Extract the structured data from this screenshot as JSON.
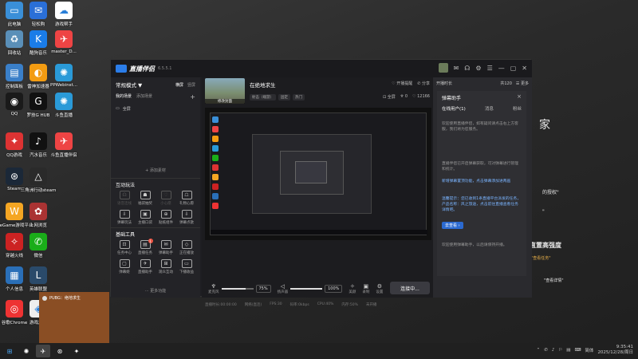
{
  "desktop": {
    "icons": [
      {
        "label": "此电脑",
        "glyph": "▭",
        "color": "#3a8fd8"
      },
      {
        "label": "回收站",
        "glyph": "♻",
        "color": "#5a8fb8"
      },
      {
        "label": "控制面板",
        "glyph": "▤",
        "color": "#3a7fc8"
      },
      {
        "label": "QQ",
        "glyph": "◉",
        "color": "#1a1a1a"
      },
      {
        "label": "QQ游戏",
        "glyph": "✦",
        "color": "#d33"
      },
      {
        "label": "Steam",
        "glyph": "⊛",
        "color": "#1b2838"
      },
      {
        "label": "WeGame游戏平台",
        "glyph": "W",
        "color": "#f5a623"
      },
      {
        "label": "穿越火线",
        "glyph": "✧",
        "color": "#c22"
      },
      {
        "label": "个人信息",
        "glyph": "▦",
        "color": "#2a6fb8"
      },
      {
        "label": "谷歌Chrome",
        "glyph": "◎",
        "color": "#e33"
      },
      {
        "label": "轻松购",
        "glyph": "✉",
        "color": "#2a6fd8"
      },
      {
        "label": "酷狗音乐",
        "glyph": "K",
        "color": "#1a7ce8"
      },
      {
        "label": "雷神加速器",
        "glyph": "◐",
        "color": "#f39c12"
      },
      {
        "label": "罗技G HUB",
        "glyph": "G",
        "color": "#111"
      },
      {
        "label": "汽水音乐",
        "glyph": "♪",
        "color": "#111"
      },
      {
        "label": "三角洲行动steam",
        "glyph": "△",
        "color": "#2a2a2a"
      },
      {
        "label": "上网浏览",
        "glyph": "✿",
        "color": "#a33"
      },
      {
        "label": "微信",
        "glyph": "✆",
        "color": "#1aad19"
      },
      {
        "label": "英雄联盟",
        "glyph": "L",
        "color": "#2a4a6a"
      },
      {
        "label": "游戏加速",
        "glyph": "◈",
        "color": "#eee"
      },
      {
        "label": "游戏帮手",
        "glyph": "☁",
        "color": "#fff"
      },
      {
        "label": "master_D...",
        "glyph": "✈",
        "color": "#e44"
      },
      {
        "label": "PPWebinst...",
        "glyph": "✺",
        "color": "#2a9ad8"
      },
      {
        "label": "斗鱼直播",
        "glyph": "✺",
        "color": "#2a9ad8"
      },
      {
        "label": "斗鱼直播伴侣",
        "glyph": "✈",
        "color": "#e44"
      }
    ],
    "bg_text": {
      "line1": "家",
      "line2": "的授权\"",
      "line3": "\"",
      "line4": "直置高强度",
      "line5": "\"查看任务\"",
      "line6": "\"查看详情\""
    }
  },
  "app": {
    "name": "直播伴侣",
    "version": "6.5.5.1",
    "title_icons": [
      "chat",
      "headset",
      "settings",
      "list",
      "minimize",
      "maximize",
      "close"
    ],
    "mode": {
      "label": "常规模式 ▼",
      "tab_horizontal": "横屏",
      "tab_vertical": "竖屏"
    },
    "scenes": {
      "my_scenes": "我的场景",
      "add_scene": "添加场景"
    },
    "source_item": "全屏",
    "add_source": "+ 添加素材",
    "interactive": {
      "title": "互动玩法",
      "tools": [
        {
          "label": "语音连线",
          "glyph": "☊",
          "dim": true
        },
        {
          "label": "福袋抽奖",
          "glyph": "☗",
          "dim": false
        },
        {
          "label": "小心愿",
          "glyph": "♡",
          "dim": true
        },
        {
          "label": "礼物心愿",
          "glyph": "☖",
          "dim": false
        },
        {
          "label": "弹幕玩法",
          "glyph": "⇩",
          "dim": false
        },
        {
          "label": "主播口袋",
          "glyph": "▣",
          "dim": false
        },
        {
          "label": "贴纸组件",
          "glyph": "⊕",
          "dim": false
        },
        {
          "label": "弹幕点歌",
          "glyph": "⇩",
          "dim": false
        }
      ]
    },
    "basic": {
      "title": "基础工具",
      "tools": [
        {
          "label": "任务中心",
          "glyph": "⊡",
          "badge": ""
        },
        {
          "label": "直播任务",
          "glyph": "▤",
          "badge": "1"
        },
        {
          "label": "弹幕助手",
          "glyph": "✉",
          "badge": ""
        },
        {
          "label": "正在播放",
          "glyph": "◇",
          "badge": ""
        },
        {
          "label": "弹幕姬",
          "glyph": "▢",
          "badge": ""
        },
        {
          "label": "直播助手",
          "glyph": "✈",
          "badge": ""
        },
        {
          "label": "观众互动",
          "glyph": "⊞",
          "badge": ""
        },
        {
          "label": "下播收益",
          "glyph": "▭",
          "badge": ""
        }
      ]
    },
    "more_features": "··· 更多功能",
    "stream": {
      "cover_label": "修改封面",
      "title": "在绝地求生",
      "tags": [
        "射击（端游）",
        "固定",
        "热门"
      ],
      "right_top": [
        "♡ 开播提醒",
        "✆ 分享"
      ],
      "right_bottom": [
        "⊡ 全屏",
        "♆ 0",
        "♡ 12166"
      ]
    },
    "controls": {
      "mic_label": "麦克风",
      "mic_pct": "75%",
      "speaker_label": "扬声器",
      "speaker_pct": "100%",
      "effect_label": "美颜",
      "record_label": "录制",
      "settings_label": "设置",
      "go_live": "连接中..."
    },
    "status": {
      "live_time": "直播时长:00:00:00",
      "network": "网络(直连)",
      "fps": "FPS:30",
      "bitrate": "码率:0kbps",
      "cpu": "CPU:40%",
      "memory": "内存:50%",
      "state": "未开播"
    },
    "right_header": {
      "label1": "开播时长",
      "label2": "共120",
      "label3": "☰ 更多"
    },
    "assistant": {
      "title": "弹幕助手",
      "close": "×",
      "tabs": [
        "在线用户(1)",
        "消息",
        "粉丝"
      ],
      "paragraphs": [
        "欢迎使用直播伴侣，如有疑问请点击右上方客服，我们将为您服务。",
        "直播伴侣已开启弹幕获取，可对弹幕进行管理和统计。",
        "新增弹幕置顶功能，点击弹幕添加进两画",
        "温馨提示：您已收到1条直播平台派发的任务，产品名称：风之旅途，点击前往直播查看任务详情吧。",
        "欢迎使用弹幕助手，以后请保持开播。"
      ],
      "view_btn": "去查看 ›"
    }
  },
  "notification": {
    "text": "PUBG：绝地求生"
  },
  "taskbar": {
    "apps": [
      {
        "glyph": "⊞",
        "name": "start"
      },
      {
        "glyph": "✺",
        "name": "douyu"
      },
      {
        "glyph": "✈",
        "name": "live-companion"
      },
      {
        "glyph": "⊛",
        "name": "steam"
      },
      {
        "glyph": "✦",
        "name": "game"
      }
    ],
    "tray": [
      "⌃",
      "✆",
      "♪",
      "⚐",
      "▤",
      "⌨"
    ],
    "lang": "简体",
    "time": "9:35:41",
    "date": "2025/12/28/周日"
  }
}
